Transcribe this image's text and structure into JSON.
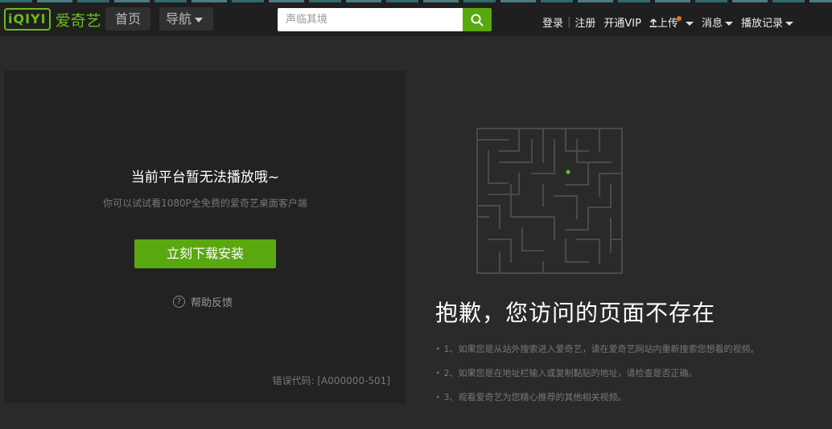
{
  "header": {
    "logo_mark": "iQIYI",
    "logo_text": "爱奇艺",
    "nav_home": "首页",
    "nav_guide": "导航",
    "search_placeholder": "声临其境",
    "links": {
      "login": "登录",
      "divider": "|",
      "register": "注册",
      "vip": "开通VIP",
      "upload": "上传",
      "messages": "消息",
      "history": "播放记录"
    }
  },
  "left_panel": {
    "title": "当前平台暂无法播放哦~",
    "subtitle": "你可以试试看1080P全免费的爱奇艺桌面客户端",
    "download_button": "立刻下载安装",
    "help_icon_glyph": "?",
    "help_label": "帮助反馈",
    "error_code": "错误代码: [A000000-501]"
  },
  "right_panel": {
    "heading": "抱歉，您访问的页面不存在",
    "tips": [
      "1、如果您是从站外搜索进入爱奇艺，请在爱奇艺网站内重新搜索您想看的视频。",
      "2、如果您是在地址栏输入或复制黏贴的地址，请检查是否正确。",
      "3、观看爱奇艺为您精心推荐的其他相关视频。"
    ],
    "bullet": "•"
  },
  "colors": {
    "brand_green": "#5aa80f",
    "logo_green": "#6cba1f",
    "background": "#2a2a2a",
    "header": "#1f1f1f",
    "notification_dot": "#f06a2a"
  },
  "icons": {
    "search": "search-icon",
    "upload": "upload-arrow-icon",
    "help": "question-circle-icon",
    "maze": "maze-illustration"
  }
}
